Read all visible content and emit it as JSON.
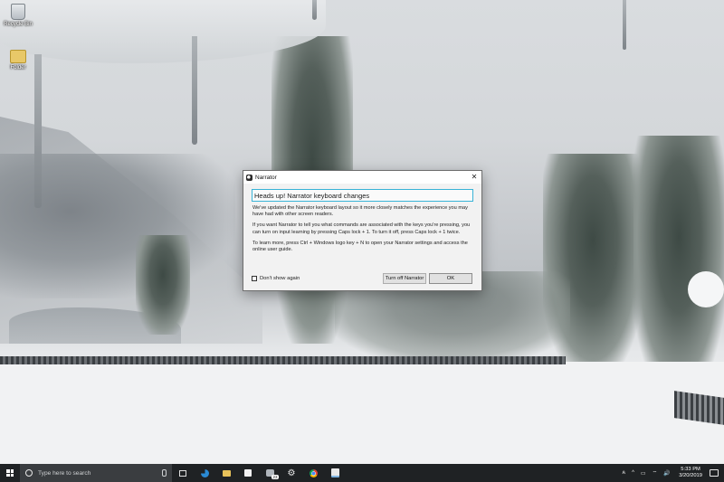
{
  "desktop": {
    "icons": [
      {
        "label": "Recycle Bin",
        "icon": "recycle-bin-icon"
      },
      {
        "label": "Folder",
        "icon": "folder-icon"
      }
    ]
  },
  "dialog": {
    "title": "Narrator",
    "heading": "Heads up! Narrator keyboard changes",
    "paragraphs": [
      "We've updated the Narrator keyboard layout so it more closely matches the experience you may have had with other screen readers.",
      "If you want Narrator to tell you what commands are associated with the keys you're pressing, you can turn on input learning by pressing Caps lock + 1. To turn it off, press Caps lock + 1 twice.",
      "To learn more, press Ctrl + Windows logo key + N to open your Narrator settings and access the online user guide."
    ],
    "checkbox_label": "Don't show again",
    "checkbox_checked": false,
    "turn_off_label": "Turn off Narrator",
    "ok_label": "OK",
    "close_glyph": "✕"
  },
  "taskbar": {
    "search_placeholder": "Type here to search",
    "apps": [
      "task-view-icon",
      "edge-icon",
      "file-explorer-icon",
      "store-icon",
      "app-with-badge-icon",
      "settings-icon",
      "chrome-icon",
      "narrator-icon"
    ],
    "badge_count": "23",
    "gear_glyph": "⚙",
    "tray": {
      "people": "ጰ",
      "chevron": "^",
      "battery": "▭",
      "network": "⌔",
      "volume": "🔊"
    },
    "time": "5:33 PM",
    "date": "3/20/2019"
  }
}
